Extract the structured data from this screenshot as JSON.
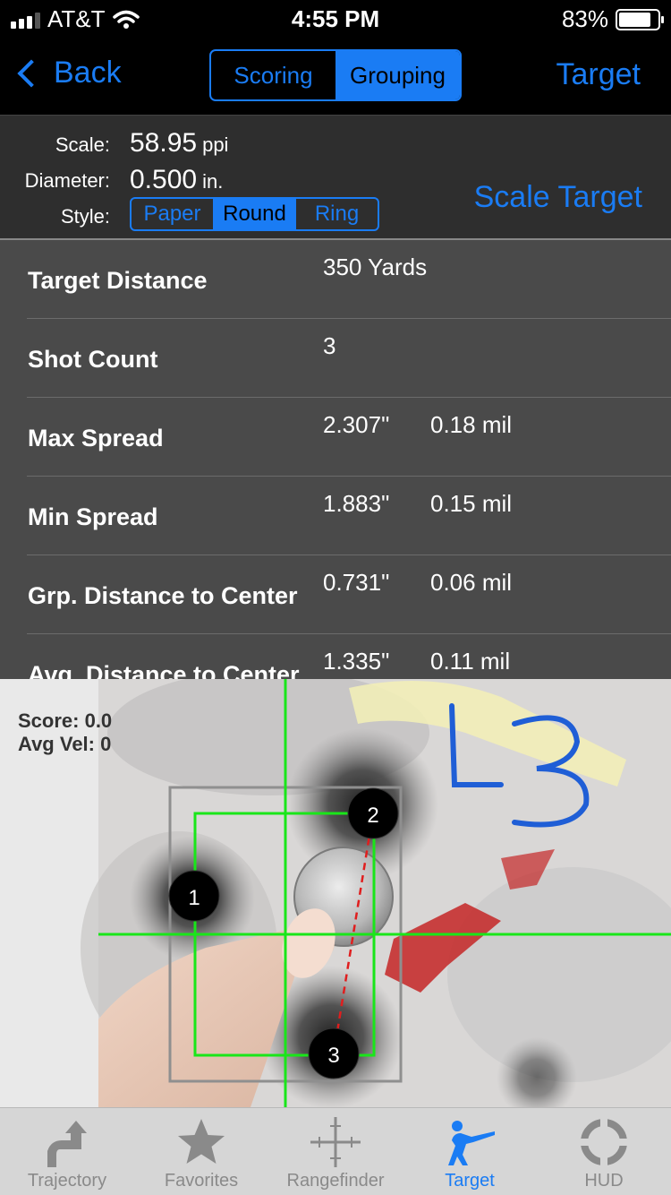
{
  "status_bar": {
    "carrier": "AT&T",
    "time": "4:55 PM",
    "battery_text": "83%",
    "battery_level": 0.83
  },
  "nav": {
    "back_label": "Back",
    "segments": [
      "Scoring",
      "Grouping"
    ],
    "selected_segment": "Grouping",
    "right_label": "Target"
  },
  "scale_panel": {
    "scale_label": "Scale:",
    "scale_value": "58.95",
    "scale_unit": "ppi",
    "diameter_label": "Diameter:",
    "diameter_value": "0.500",
    "diameter_unit": "in.",
    "style_label": "Style:",
    "style_options": [
      "Paper",
      "Round",
      "Ring"
    ],
    "selected_style": "Round",
    "scale_target_label": "Scale Target"
  },
  "stats": [
    {
      "name": "Target Distance",
      "value1": "350 Yards",
      "value2": ""
    },
    {
      "name": "Shot Count",
      "value1": "3",
      "value2": ""
    },
    {
      "name": "Max Spread",
      "value1": "2.307\"",
      "value2": "0.18 mil"
    },
    {
      "name": "Min Spread",
      "value1": "1.883\"",
      "value2": "0.15 mil"
    },
    {
      "name": "Grp. Distance to Center",
      "value1": "0.731\"",
      "value2": "0.06 mil"
    },
    {
      "name": "Avg. Distance to Center",
      "value1": "1.335\"",
      "value2": "0.11 mil"
    }
  ],
  "target_view": {
    "score_text": "Score: 0.0",
    "avg_vel_text": "Avg Vel: 0",
    "handwritten_mark": "L3",
    "shot_labels": [
      "1",
      "2",
      "3"
    ],
    "accent_green": "#19e619",
    "accent_red": "#e01e1e"
  },
  "tabs": [
    {
      "label": "Trajectory",
      "icon": "trajectory-icon",
      "active": false
    },
    {
      "label": "Favorites",
      "icon": "star-icon",
      "active": false
    },
    {
      "label": "Rangefinder",
      "icon": "crosshair-icon",
      "active": false
    },
    {
      "label": "Target",
      "icon": "rifleman-icon",
      "active": true
    },
    {
      "label": "HUD",
      "icon": "hud-reticle-icon",
      "active": false
    }
  ],
  "colors": {
    "accent": "#1a7cf4",
    "panel_dark": "#2e2e2e",
    "table_bg": "#4a4a4a",
    "tabbar_bg": "#d6d6d6"
  }
}
